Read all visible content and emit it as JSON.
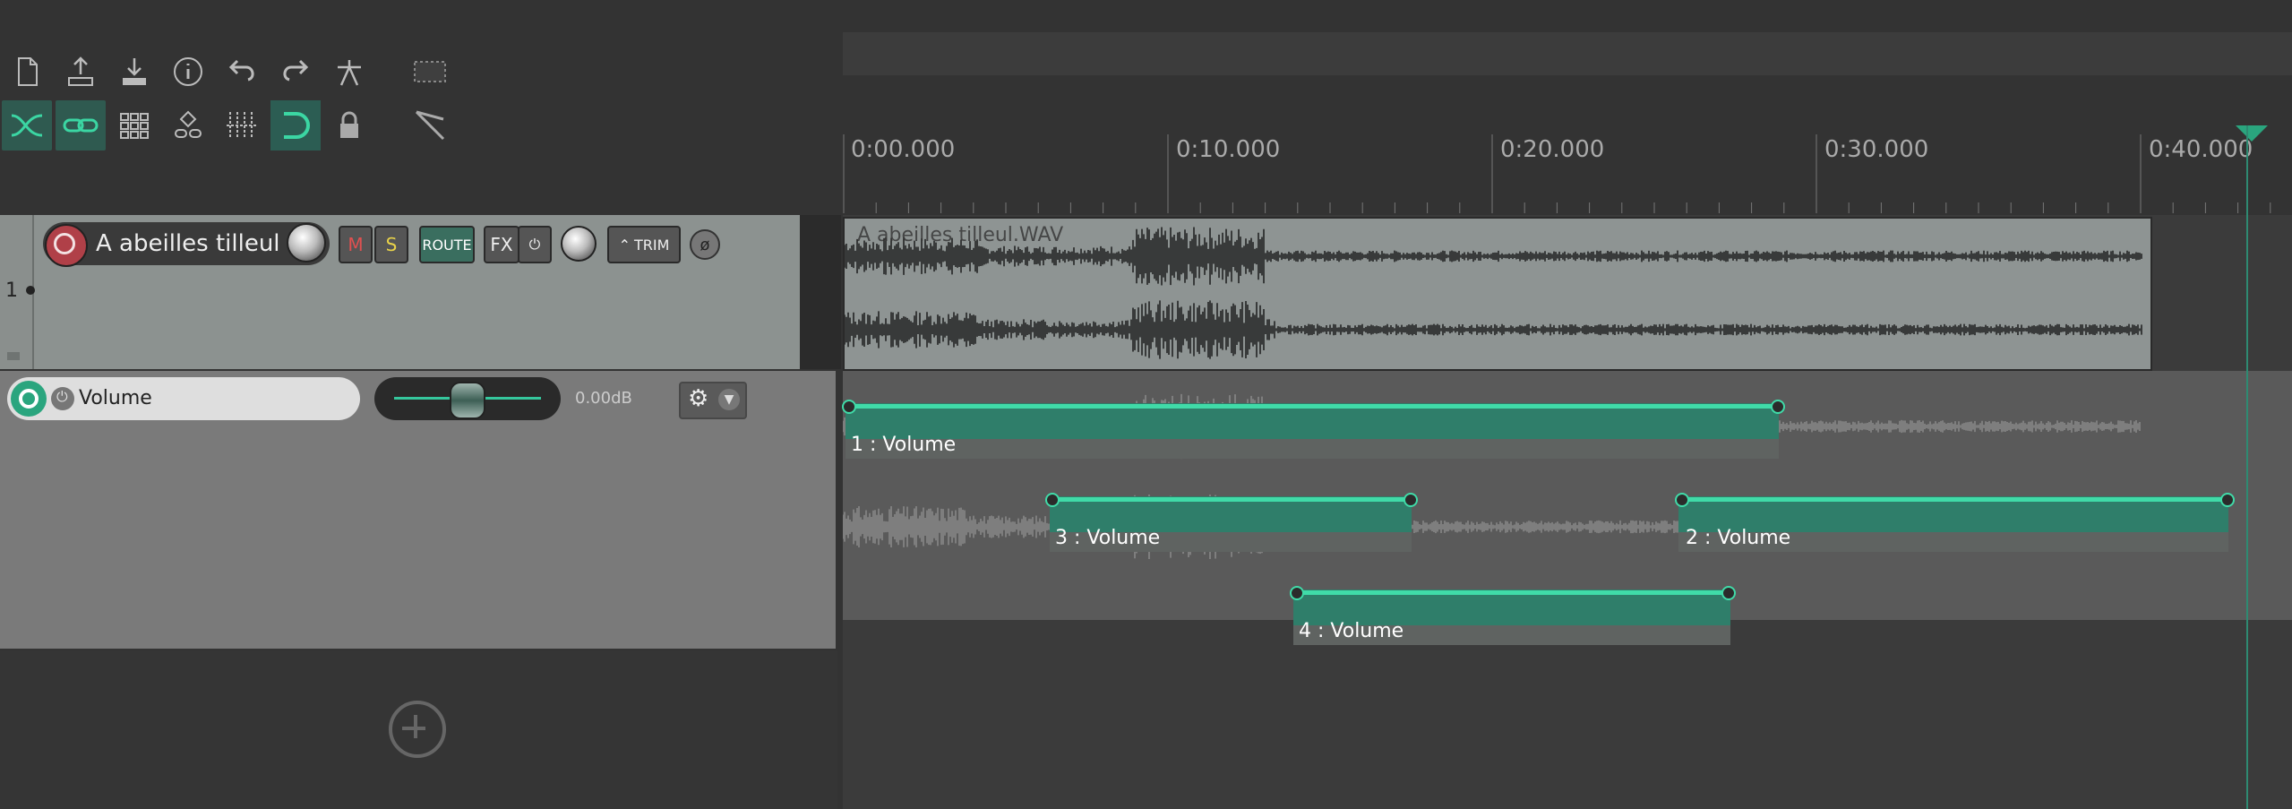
{
  "ruler": {
    "labels": [
      "0:00.000",
      "0:10.000",
      "0:20.000",
      "0:30.000",
      "0:40.000"
    ]
  },
  "track": {
    "number": "1",
    "name": "A abeilles tilleul",
    "mute": "M",
    "solo": "S",
    "route": "ROUTE",
    "fx": "FX",
    "trim": "TRIM",
    "phase": "ø"
  },
  "item": {
    "filename": "A abeilles tilleul.WAV"
  },
  "envelope": {
    "name": "Volume",
    "value": "0.00dB"
  },
  "automation_items": [
    {
      "label": "1 : Volume"
    },
    {
      "label": "3 : Volume"
    },
    {
      "label": "2 : Volume"
    },
    {
      "label": "4 : Volume"
    }
  ],
  "icons": [
    "new-project-icon",
    "save-icon",
    "load-icon",
    "info-icon",
    "undo-icon",
    "redo-icon",
    "metronome-icon",
    "marquee-icon",
    "crossfade-icon",
    "link-icon",
    "grid-icon",
    "group-icon",
    "snap-grid-icon",
    "snap-icon",
    "lock-icon",
    "ripple-icon",
    "add-icon"
  ],
  "colors": {
    "accent": "#40dba8",
    "arm_red": "#b04048",
    "item_bg": "#8e9493"
  }
}
